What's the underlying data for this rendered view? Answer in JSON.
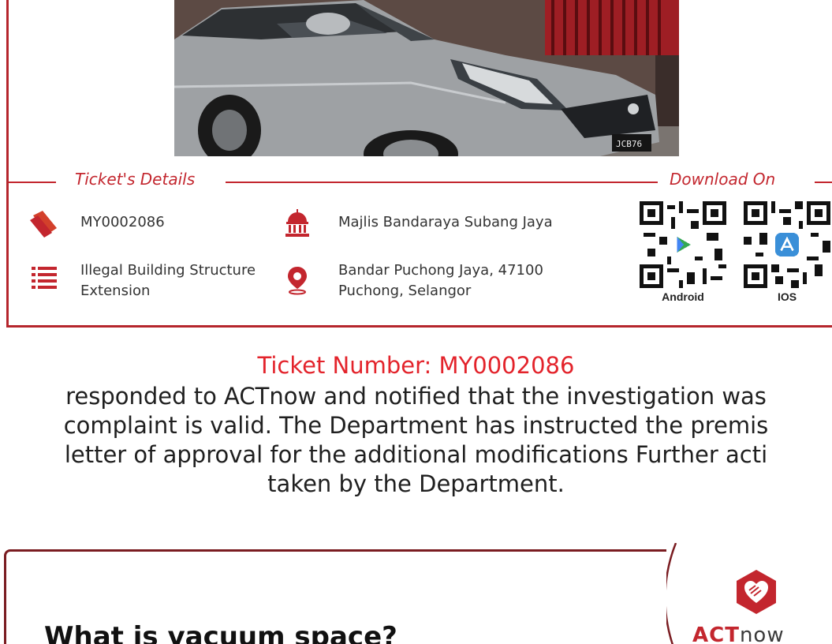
{
  "ticket_card": {
    "section_details_title": "Ticket's Details",
    "section_download_title": "Download On",
    "ticket_id": "MY0002086",
    "category_line1": "Illegal Building Structure",
    "category_line2": "Extension",
    "authority": "Majlis Bandaraya Subang Jaya",
    "location_line1": "Bandar Puchong Jaya, 47100",
    "location_line2": "Puchong, Selangor",
    "plate": "JCB76",
    "download": [
      {
        "label": "Android",
        "icon": "play-store-icon"
      },
      {
        "label": "IOS",
        "icon": "app-store-icon"
      }
    ],
    "accent_color": "#c3262e"
  },
  "caption": {
    "title": "Ticket Number: MY0002086",
    "lines": [
      "responded to ACTnow and notified that the investigation was",
      "complaint is valid. The Department has instructed the premis",
      "letter of approval for the additional modifications Further acti",
      "taken by the Department."
    ],
    "title_color": "#e3232b"
  },
  "bottom_card": {
    "heading": "What is vacuum space?",
    "logo_act": "ACT",
    "logo_now": "now"
  }
}
